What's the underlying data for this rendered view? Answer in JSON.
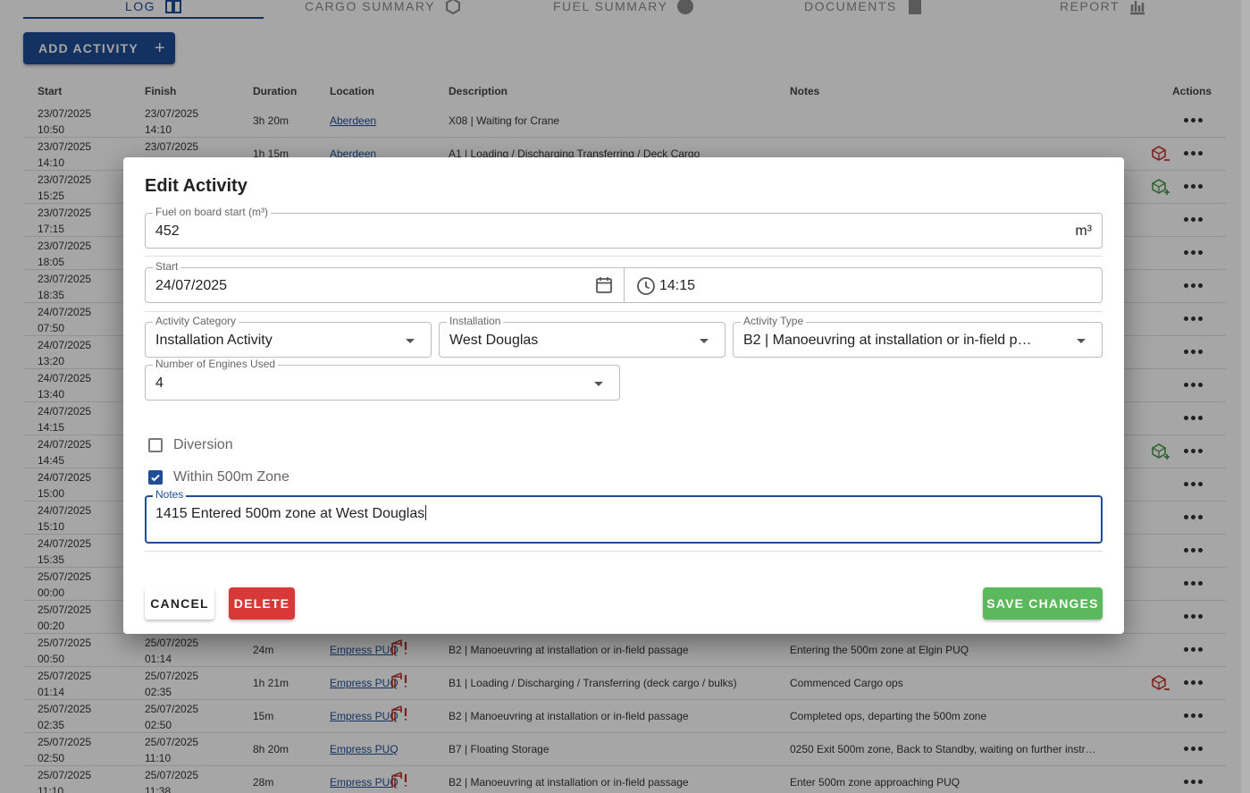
{
  "tabs": [
    {
      "label": "LOG",
      "icon": "book-icon",
      "active": true
    },
    {
      "label": "CARGO SUMMARY",
      "icon": "cube-icon"
    },
    {
      "label": "FUEL SUMMARY",
      "icon": "fuel-icon"
    },
    {
      "label": "DOCUMENTS",
      "icon": "document-icon"
    },
    {
      "label": "REPORT",
      "icon": "chart-icon"
    }
  ],
  "add_activity_label": "ADD ACTIVITY",
  "table": {
    "headers": {
      "start": "Start",
      "finish": "Finish",
      "duration": "Duration",
      "location": "Location",
      "description": "Description",
      "notes": "Notes",
      "actions": "Actions"
    },
    "rows": [
      {
        "start_date": "23/07/2025",
        "start_time": "10:50",
        "finish_date": "23/07/2025",
        "finish_time": "14:10",
        "duration": "3h 20m",
        "location": "Aberdeen",
        "description": "X08 | Waiting for Crane",
        "notes": ""
      },
      {
        "start_date": "23/07/2025",
        "start_time": "14:10",
        "finish_date": "23/07/2025",
        "finish_time": "",
        "duration": "1h 15m",
        "location": "Aberdeen",
        "description": "A1 | Loading / Discharging Transferring / Deck Cargo",
        "notes": "",
        "cargo": "remove"
      },
      {
        "start_date": "23/07/2025",
        "start_time": "15:25",
        "finish_date": "",
        "finish_time": "",
        "duration": "",
        "location": "",
        "description": "",
        "notes": "",
        "cargo": "add"
      },
      {
        "start_date": "23/07/2025",
        "start_time": "17:15"
      },
      {
        "start_date": "23/07/2025",
        "start_time": "18:05"
      },
      {
        "start_date": "23/07/2025",
        "start_time": "18:35"
      },
      {
        "start_date": "24/07/2025",
        "start_time": "07:50"
      },
      {
        "start_date": "24/07/2025",
        "start_time": "13:20"
      },
      {
        "start_date": "24/07/2025",
        "start_time": "13:40"
      },
      {
        "start_date": "24/07/2025",
        "start_time": "14:15"
      },
      {
        "start_date": "24/07/2025",
        "start_time": "14:45",
        "cargo": "add"
      },
      {
        "start_date": "24/07/2025",
        "start_time": "15:00"
      },
      {
        "start_date": "24/07/2025",
        "start_time": "15:10"
      },
      {
        "start_date": "24/07/2025",
        "start_time": "15:35"
      },
      {
        "start_date": "25/07/2025",
        "start_time": "00:00"
      },
      {
        "start_date": "25/07/2025",
        "start_time": "00:20"
      },
      {
        "start_date": "25/07/2025",
        "start_time": "00:50",
        "finish_date": "25/07/2025",
        "finish_time": "01:14",
        "duration": "24m",
        "location": "Empress PUQ",
        "crane": true,
        "description": "B2 | Manoeuvring at installation or in-field passage",
        "notes": "Entering the 500m zone at Elgin PUQ"
      },
      {
        "start_date": "25/07/2025",
        "start_time": "01:14",
        "finish_date": "25/07/2025",
        "finish_time": "02:35",
        "duration": "1h 21m",
        "location": "Empress PUQ",
        "crane": true,
        "description": "B1 | Loading / Discharging / Transferring (deck cargo / bulks)",
        "notes": "Commenced Cargo ops",
        "cargo": "remove"
      },
      {
        "start_date": "25/07/2025",
        "start_time": "02:35",
        "finish_date": "25/07/2025",
        "finish_time": "02:50",
        "duration": "15m",
        "location": "Empress PUQ",
        "crane": true,
        "description": "B2 | Manoeuvring at installation or in-field passage",
        "notes": "Completed ops, departing the 500m zone"
      },
      {
        "start_date": "25/07/2025",
        "start_time": "02:50",
        "finish_date": "25/07/2025",
        "finish_time": "11:10",
        "duration": "8h 20m",
        "location": "Empress PUQ",
        "crane": false,
        "description": "B7 | Floating Storage",
        "notes": "0250 Exit 500m zone, Back to Standby, waiting on further instr…"
      },
      {
        "start_date": "25/07/2025",
        "start_time": "11:10",
        "finish_date": "25/07/2025",
        "finish_time": "11:38",
        "duration": "28m",
        "location": "Empress PUQ",
        "crane": true,
        "description": "B2 | Manoeuvring at installation or in-field passage",
        "notes": "Enter 500m zone approaching PUQ"
      }
    ]
  },
  "dialog": {
    "title": "Edit Activity",
    "fuel": {
      "label": "Fuel on board start (m³)",
      "value": "452",
      "unit": "m³"
    },
    "start": {
      "label": "Start",
      "date": "24/07/2025",
      "time": "14:15"
    },
    "activity_category": {
      "label": "Activity Category",
      "value": "Installation Activity"
    },
    "installation": {
      "label": "Installation",
      "value": "West Douglas"
    },
    "activity_type": {
      "label": "Activity Type",
      "value": "B2 | Manoeuvring at installation or in-field p…"
    },
    "engines": {
      "label": "Number of Engines Used",
      "value": "4"
    },
    "diversion": {
      "label": "Diversion",
      "checked": false
    },
    "within_zone": {
      "label": "Within 500m Zone",
      "checked": true
    },
    "notes": {
      "label": "Notes",
      "value": "1415 Entered 500m zone at West Douglas"
    },
    "buttons": {
      "cancel": "CANCEL",
      "delete": "DELETE",
      "save": "SAVE CHANGES"
    }
  },
  "colors": {
    "primary": "#1f4e95",
    "danger": "#d93838",
    "success": "#5cb85c"
  }
}
